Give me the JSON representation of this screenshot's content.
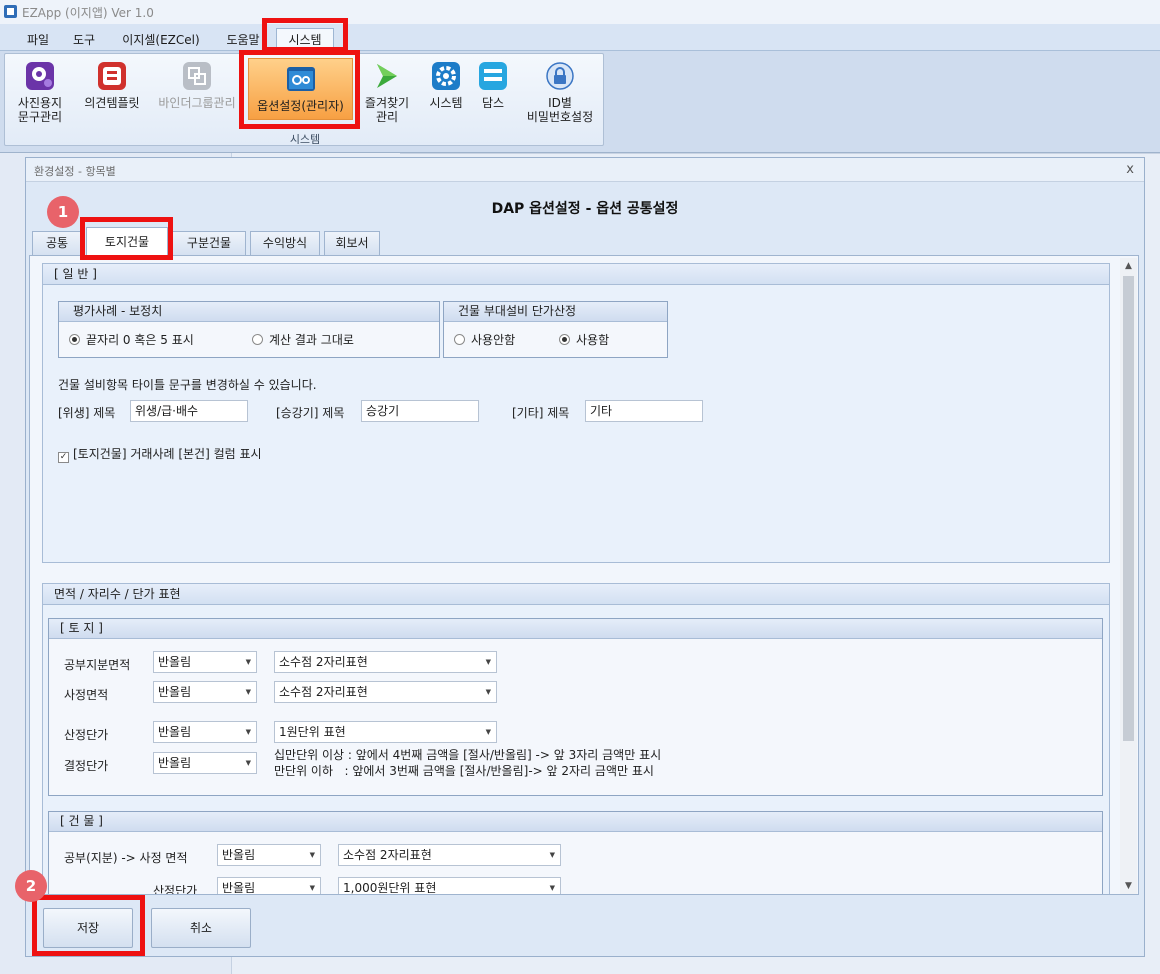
{
  "app": {
    "title": "EZApp (이지앱)  Ver 1.0"
  },
  "menu": {
    "file": "파일",
    "tools": "도구",
    "ezcel": "이지셀(EZCel)",
    "help": "도움말",
    "system": "시스템"
  },
  "ribbon": {
    "photo": "사진용지\n문구관리",
    "opinion": "의견템플릿",
    "binder": "바인더그룹관리",
    "options": "옵션설정(관리자)",
    "favorites": "즐겨찾기\n관리",
    "system": "시스템",
    "dams": "담스",
    "password": "ID별\n비밀번호설정",
    "group_label": "시스템"
  },
  "dialog": {
    "title": "환경설정 - 항목별",
    "close": "x",
    "heading": "DAP 옵션설정 - 옵션 공통설정",
    "tabs": {
      "common": "공통",
      "land_building": "토지건물",
      "compartment": "구분건물",
      "income": "수익방식",
      "report": "회보서"
    },
    "general": {
      "header": "[ 일 반 ]",
      "eval": {
        "header": "평가사례 - 보정치",
        "opt1": "끝자리 0 혹은 5 표시",
        "opt2": "계산 결과 그대로"
      },
      "equip": {
        "header": "건물 부대설비 단가산정",
        "opt1": "사용안함",
        "opt2": "사용함"
      },
      "notice": "건물 설비항목 타이틀 문구를 변경하실 수 있습니다.",
      "sanitation_label": "[위생] 제목",
      "sanitation_value": "위생/급·배수",
      "elevator_label": "[승강기] 제목",
      "elevator_value": "승강기",
      "etc_label": "[기타] 제목",
      "etc_value": "기타",
      "checkbox_label": "[토지건물] 거래사례 [본건] 컬럼 표시",
      "checkbox_checked": true
    },
    "area": {
      "header": "면적 / 자리수 / 단가 표현",
      "land": {
        "header": "[ 토 지 ]",
        "public_area_label": "공부지분면적",
        "public_area_round": "반올림",
        "public_area_fmt": "소수점 2자리표현",
        "survey_area_label": "사정면적",
        "survey_area_round": "반올림",
        "survey_area_fmt": "소수점 2자리표현",
        "calc_price_label": "산정단가",
        "calc_price_round": "반올림",
        "calc_price_fmt": "1원단위 표현",
        "final_price_label": "결정단가",
        "final_price_round": "반올림",
        "note1": "십만단위 이상 : 앞에서 4번째 금액을 [절사/반올림] -> 앞 3자리 금액만 표시",
        "note2": "만단위 이하   : 앞에서 3번째 금액을 [절사/반올림]-> 앞 2자리 금액만 표시"
      },
      "building": {
        "header": "[ 건 물 ]",
        "area_label": "공부(지분) -> 사정 면적",
        "area_round": "반올림",
        "area_fmt": "소수점 2자리표현",
        "price_label": "산정단가",
        "price_round": "반올림",
        "price_fmt": "1,000원단위 표현"
      }
    },
    "buttons": {
      "save": "저장",
      "cancel": "취소"
    }
  },
  "badges": {
    "one": "1",
    "two": "2"
  },
  "colors": {
    "highlight": "#ee1111",
    "badge": "#e8636a",
    "ribbon_active": "#f7a043"
  }
}
